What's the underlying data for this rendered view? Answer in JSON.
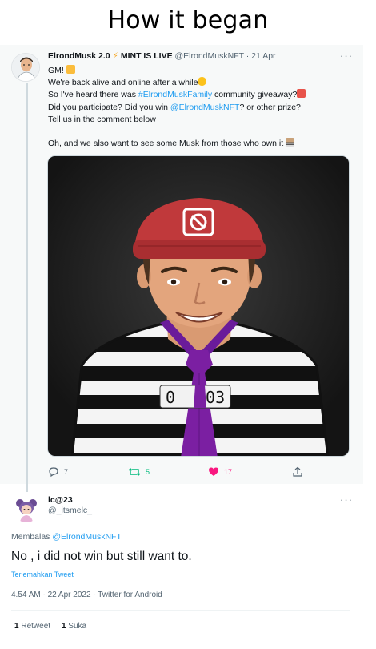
{
  "meme": {
    "title": "How it began"
  },
  "tweet": {
    "author_name": "ElrondMusk 2.0",
    "author_suffix": "MINT IS LIVE",
    "handle": "@ElrondMuskNFT",
    "date": "· 21 Apr",
    "more": "···",
    "lines": {
      "l1": "GM!",
      "l2": "We're back alive and online after a while",
      "l3_pre": "So I've heard there was ",
      "l3_link": "#ElrondMuskFamily",
      "l3_post": " community giveaway?",
      "l4_pre": "Did you participate? Did you win ",
      "l4_link": "@ElrondMuskNFT",
      "l4_post": "? or other prize?",
      "l5": "Tell us in the comment below",
      "l6": "Oh, and we also want to see some Musk from those who own it"
    },
    "image": {
      "prisoner_number": "203",
      "number_prefix": "0"
    },
    "actions": {
      "replies": "7",
      "retweets": "5",
      "likes": "17"
    }
  },
  "reply": {
    "author_name": "lc@23",
    "handle": "@_itsmelc_",
    "more": "···",
    "replying_prefix": "Membalas ",
    "replying_to": "@ElrondMuskNFT",
    "text": "No , i did not win but still want to.",
    "translate": "Terjemahkan Tweet",
    "meta": "4.54 AM · 22 Apr 2022 · Twitter for Android",
    "retweets_count": "1",
    "retweets_label": "Retweet",
    "likes_count": "1",
    "likes_label": "Suka"
  },
  "colors": {
    "accent": "#1d9bf0",
    "retweet": "#00ba7c",
    "like": "#f91880",
    "muted": "#536471"
  }
}
